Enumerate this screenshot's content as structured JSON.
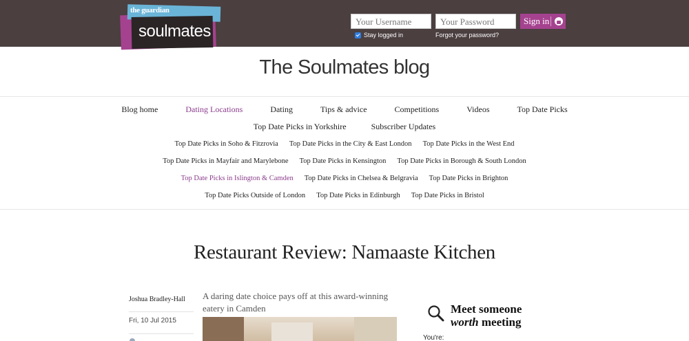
{
  "header": {
    "logo_top": "the guardian",
    "logo_main": "soulmates",
    "username_placeholder": "Your Username",
    "password_placeholder": "Your Password",
    "signin_label": "Sign in",
    "stay_logged_in": "Stay logged in",
    "forgot_password": "Forgot your password?"
  },
  "blog_title": "The Soulmates blog",
  "nav": {
    "row1": [
      "Blog home",
      "Dating Locations",
      "Dating",
      "Tips & advice",
      "Competitions",
      "Videos",
      "Top Date Picks"
    ],
    "row2": [
      "Top Date Picks in Yorkshire",
      "Subscriber Updates"
    ],
    "row3": [
      "Top Date Picks in Soho & Fitzrovia",
      "Top Date Picks in the City & East London",
      "Top Date Picks in the West End"
    ],
    "row4": [
      "Top Date Picks in Mayfair and Marylebone",
      "Top Date Picks in Kensington",
      "Top Date Picks in Borough & South London"
    ],
    "row5": [
      "Top Date Picks in Islington & Camden",
      "Top Date Picks in Chelsea & Belgravia",
      "Top Date Picks in Brighton"
    ],
    "row6": [
      "Top Date Picks Outside of London",
      "Top Date Picks in Edinburgh",
      "Top Date Picks in Bristol"
    ],
    "active_color": "#8b3c8c"
  },
  "article": {
    "title": "Restaurant Review: Namaaste Kitchen",
    "author": "Joshua Bradley-Hall",
    "date": "Fri, 10 Jul 2015",
    "standfirst": "A daring date choice pays off at this award-winning eatery in Camden"
  },
  "sidebar": {
    "promo_line1": "Meet someone",
    "promo_em": "worth",
    "promo_line2_rest": " meeting",
    "youre": "You're:"
  },
  "colors": {
    "header_bg": "#4b3f40",
    "brand_purple": "#a5428f",
    "logo_blue": "#6ab4d8"
  }
}
